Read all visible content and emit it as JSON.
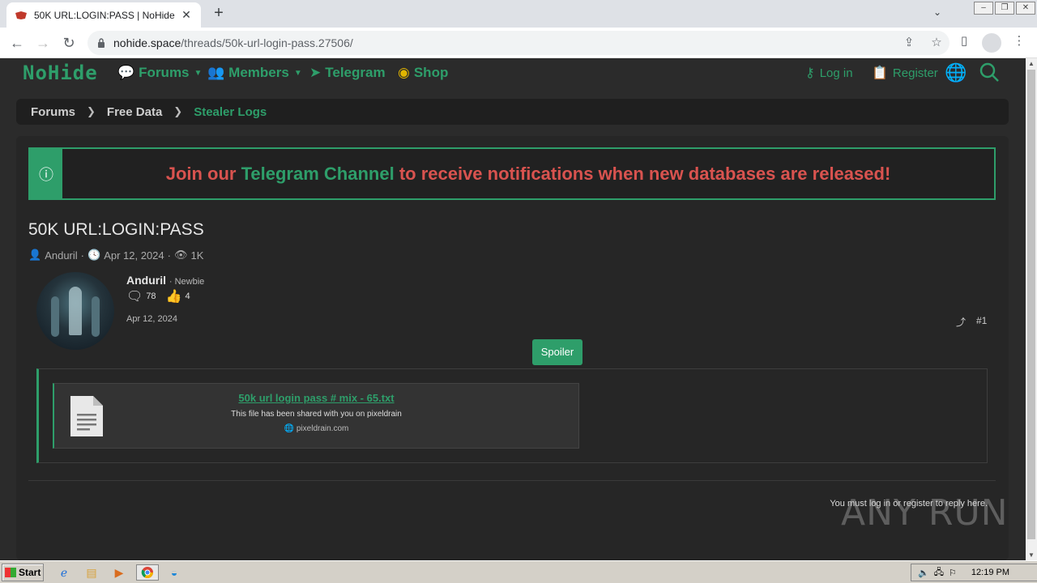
{
  "browser": {
    "tab_title": "50K URL:LOGIN:PASS | NoHide",
    "url_host": "nohide.space",
    "url_path": "/threads/50k-url-login-pass.27506/"
  },
  "site": {
    "logo": "NoHide",
    "nav": {
      "forums": "Forums",
      "members": "Members",
      "telegram": "Telegram",
      "shop": "Shop",
      "login": "Log in",
      "register": "Register"
    },
    "breadcrumb": [
      "Forums",
      "Free Data",
      "Stealer Logs"
    ],
    "notice": {
      "prefix": "Join our ",
      "highlight": "Telegram Channel",
      "suffix": " to receive notifications when new databases are released!"
    },
    "thread": {
      "title": "50K URL:LOGIN:PASS",
      "author": "Anduril",
      "date": "Apr 12, 2024",
      "views": "1K"
    },
    "post": {
      "username": "Anduril",
      "rank": "· Newbie",
      "messages": "78",
      "reactions": "4",
      "date": "Apr 12, 2024",
      "number": "#1",
      "spoiler_label": "Spoiler",
      "file_name": "50k url login pass # mix - 65.txt",
      "file_desc": "This file has been shared with you on pixeldrain",
      "file_host": "pixeldrain.com"
    },
    "reply_note": "You must log in or register to reply here."
  },
  "watermark": "ANY RUN",
  "taskbar": {
    "start": "Start",
    "clock": "12:19 PM"
  },
  "colors": {
    "accent": "#2e9e6a",
    "notice_red": "#d9534f",
    "background": "#2b2b2b"
  }
}
